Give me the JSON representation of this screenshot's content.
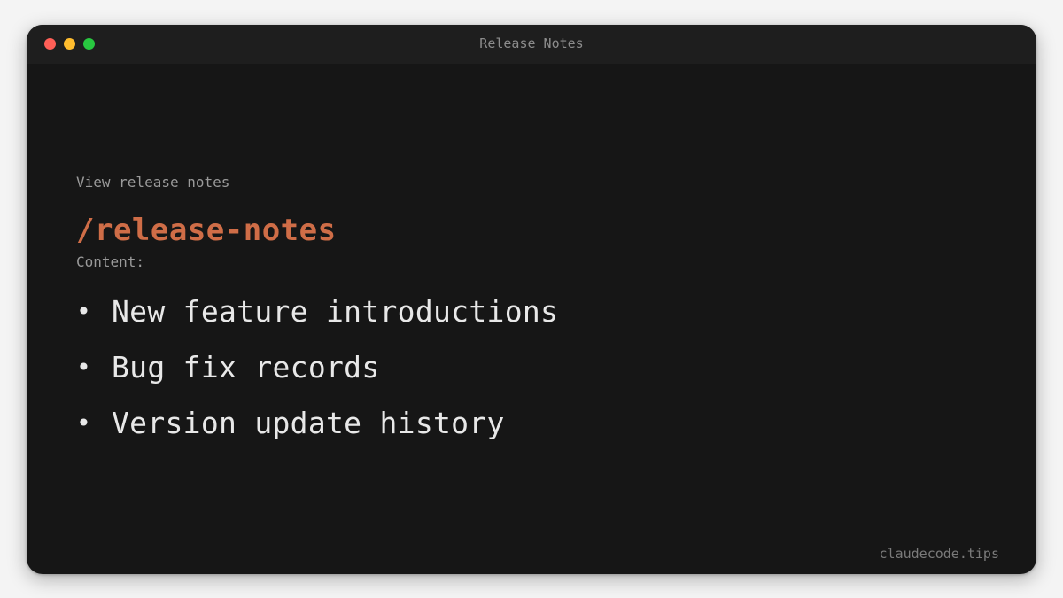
{
  "window": {
    "title": "Release Notes"
  },
  "main": {
    "subtitle": "View release notes",
    "command": "/release-notes",
    "content_label": "Content:",
    "bullets": [
      {
        "marker": "•",
        "text": "New feature introductions"
      },
      {
        "marker": "•",
        "text": "Bug fix records"
      },
      {
        "marker": "•",
        "text": "Version update history"
      }
    ]
  },
  "footer": {
    "watermark": "claudecode.tips"
  },
  "colors": {
    "background": "#161616",
    "titlebar": "#1e1e1e",
    "accent": "#cf6d47",
    "text_primary": "#e8e8e8",
    "text_secondary": "#9a9a9a",
    "traffic_close": "#ff5f57",
    "traffic_minimize": "#febc2e",
    "traffic_zoom": "#28c840"
  }
}
